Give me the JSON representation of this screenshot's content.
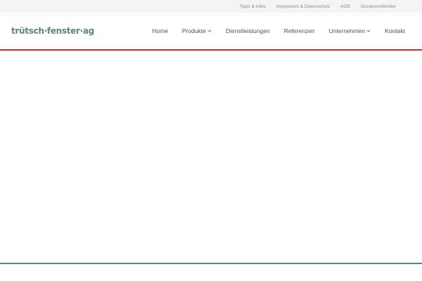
{
  "topbar": {
    "links": [
      "Tipps & Infos",
      "Impressum & Datenschutz",
      "AGB",
      "Occasionsfenster"
    ]
  },
  "header": {
    "logo_text": "trütsch·fenster·ag"
  },
  "nav": {
    "home": "Home",
    "produkte": "Produkte",
    "dienstleistungen": "Dienstleistungen",
    "referenzen": "Referenzen",
    "unternehmen": "Unternehmen",
    "kontakt": "Kontakt"
  },
  "icons": {
    "dropdown": "chevron-down-icon"
  },
  "colors": {
    "brand": "#5b8a7a",
    "accent": "#c8332b",
    "topbar_bg": "#f4f4f4"
  }
}
